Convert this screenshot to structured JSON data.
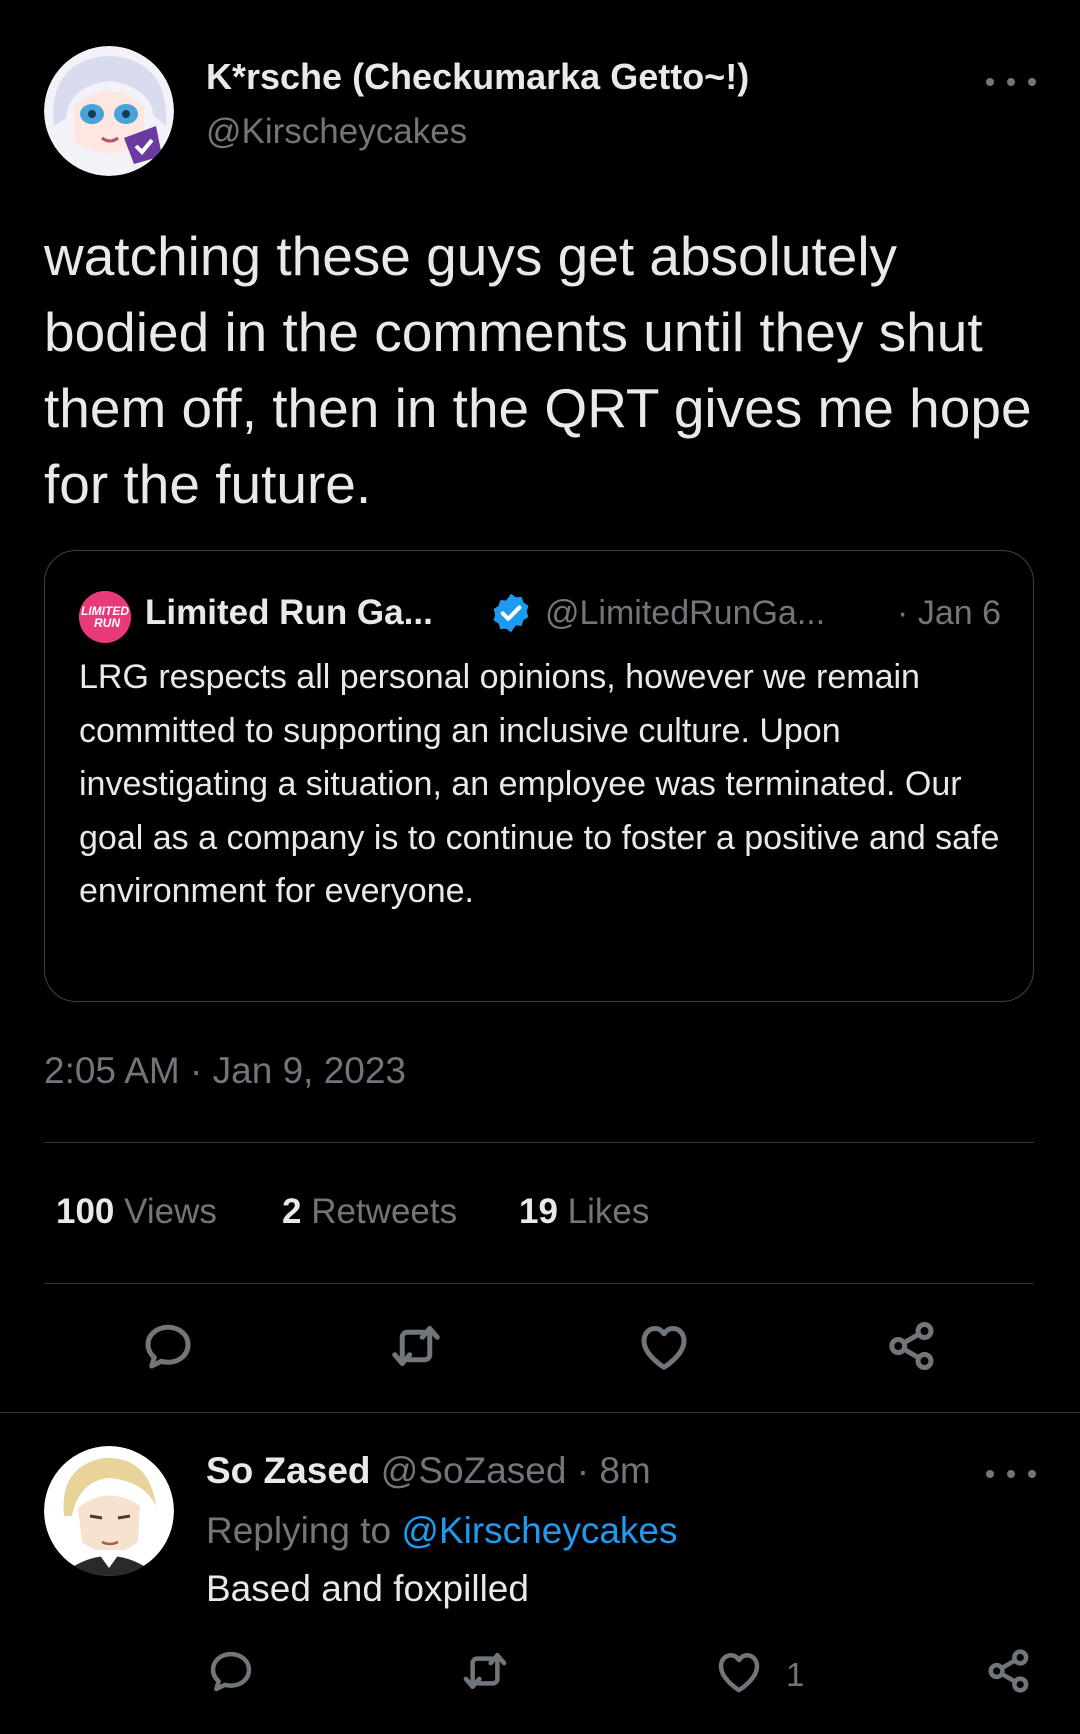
{
  "tweet": {
    "author_name": "K*rsche (Checkumarka Getto~!)",
    "author_handle": "@Kirscheycakes",
    "text": "watching these guys get absolutely bodied in the comments until they shut them off, then in the QRT gives me hope for the future.",
    "timestamp": "2:05 AM · Jan 9, 2023"
  },
  "quote": {
    "avatar_label": "LIMITED RUN",
    "name": "Limited Run Ga...",
    "handle": "@LimitedRunGa...",
    "date": "· Jan 6",
    "text": "LRG respects all personal opinions, however we remain committed to supporting an inclusive culture. Upon investigating a situation, an employee was terminated. Our goal as a company is to continue to foster a positive and safe environment for everyone."
  },
  "stats": {
    "views_count": "100",
    "views_label": "Views",
    "retweets_count": "2",
    "retweets_label": "Retweets",
    "likes_count": "19",
    "likes_label": "Likes"
  },
  "actions": [
    "reply-icon",
    "retweet-icon",
    "like-icon",
    "share-icon"
  ],
  "reply": {
    "name": "So Zased",
    "meta": "@SoZased · 8m",
    "replying_prefix": "Replying to",
    "replying_handle": "@Kirscheycakes",
    "text": "Based and foxpilled",
    "like_count": "1"
  },
  "colors": {
    "background": "#000000",
    "text": "#e7e9ea",
    "muted": "#71767b",
    "link": "#1d9bf0",
    "verified": "#1d9bf0",
    "border": "#2f3336",
    "quote_avatar": "#e83a7a"
  }
}
